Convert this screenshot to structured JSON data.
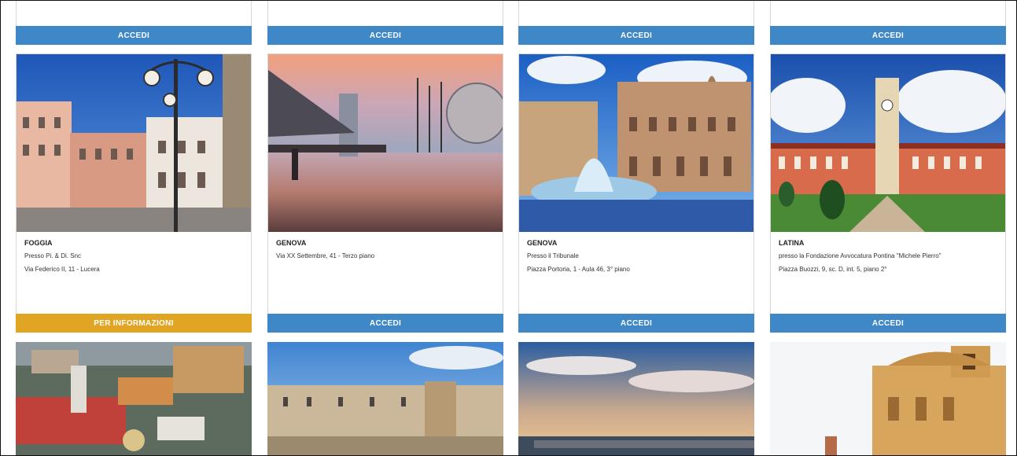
{
  "cards_top_row": [
    {
      "top_button": "ACCEDI",
      "city": "FOGGIA",
      "lines": [
        "Presso Pi. & Di. Snc",
        "Via Federico II, 11 - Lucera"
      ],
      "bottom_button": "PER INFORMAZIONI",
      "bottom_button_color": "#e0a523",
      "image_icon": "town-square-lamp-photo"
    },
    {
      "top_button": "ACCEDI",
      "city": "GENOVA",
      "lines": [
        "Via XX Settembre, 41 - Terzo piano"
      ],
      "bottom_button": "ACCEDI",
      "bottom_button_color": "#3f88c8",
      "image_icon": "harbor-sunset-photo"
    },
    {
      "top_button": "ACCEDI",
      "city": "GENOVA",
      "lines": [
        "Presso il Tribunale",
        "Piazza Portoria, 1 - Aula 46, 3° piano"
      ],
      "bottom_button": "ACCEDI",
      "bottom_button_color": "#3f88c8",
      "image_icon": "fountain-palace-photo"
    },
    {
      "top_button": "ACCEDI",
      "city": "LATINA",
      "lines": [
        "presso la Fondazione Avvocatura Pontina \"Michele Pierro\"",
        "Piazza Buozzi, 9, sc. D, int. 5, piano 2°"
      ],
      "bottom_button": "ACCEDI",
      "bottom_button_color": "#3f88c8",
      "image_icon": "clock-tower-photo"
    }
  ],
  "bottom_row_images": [
    "aerial-city-photo",
    "old-town-ruins-photo",
    "seaside-pier-photo",
    "baroque-church-photo"
  ],
  "colors": {
    "accent_blue": "#3f88c8",
    "accent_orange": "#e0a523"
  }
}
